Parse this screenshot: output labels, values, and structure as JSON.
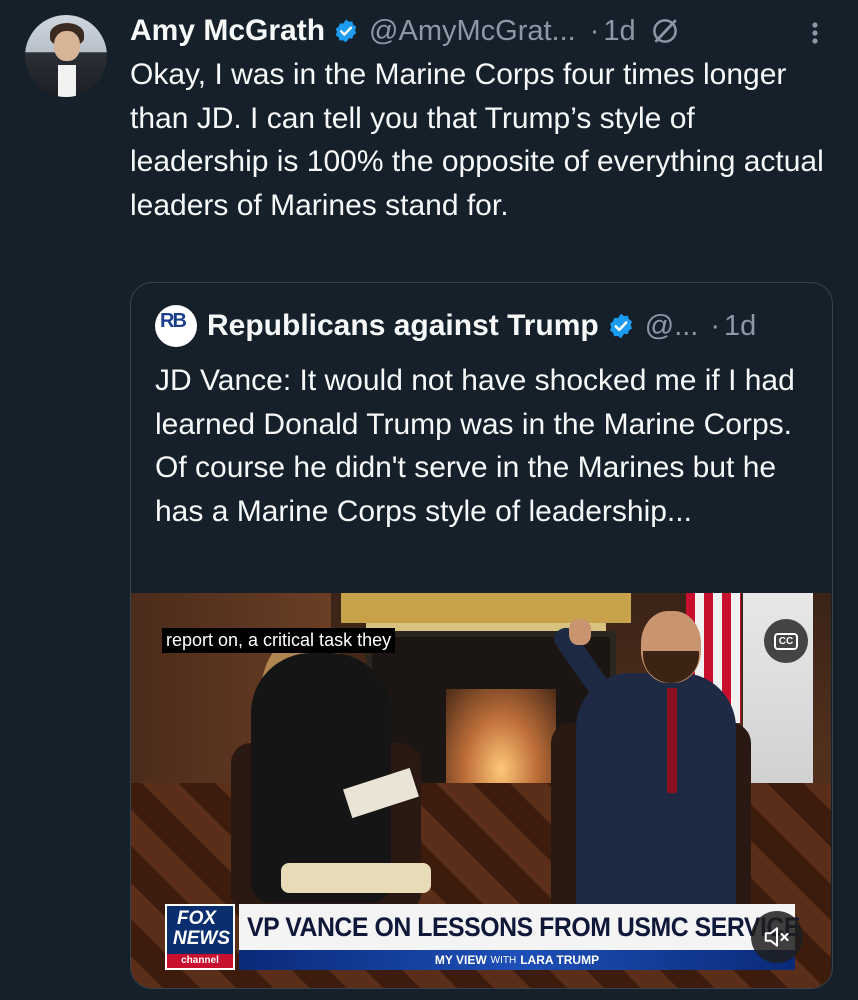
{
  "tweet": {
    "author": {
      "name": "Amy McGrath",
      "handle": "@AmyMcGrat...",
      "time": "1d",
      "separator": "·"
    },
    "text": "Okay, I was in the Marine Corps four times longer than JD. I can tell you that Trump’s style of leadership is 100% the opposite of everything actual leaders of Marines stand for.",
    "icons": [
      "verified-badge-icon",
      "grok-icon",
      "more-options-icon"
    ]
  },
  "quote": {
    "author": {
      "name": "Republicans against Trump",
      "handle": "@...",
      "time": "1d",
      "separator": "·",
      "avatar_letters": "RB"
    },
    "text": "JD Vance: It would not have shocked me if I had learned Donald Trump was in the Marine Corps. Of course he didn't serve in the Marines but he has a Marine Corps style of leadership...",
    "video": {
      "caption": "report on, a critical task they",
      "cc_label": "CC",
      "chyron_headline": "VP VANCE ON LESSONS FROM USMC SERVICE",
      "chyron_show": "MY VIEW",
      "chyron_with": "WITH",
      "chyron_host": "LARA TRUMP",
      "network_logo_top": "FOX",
      "network_logo_mid": "NEWS",
      "network_logo_bottom": "channel"
    }
  },
  "colors": {
    "background": "#15202b",
    "text_primary": "#f7f9f9",
    "text_secondary": "#8b98a5",
    "border": "#38444d",
    "verified_blue": "#1d9bf0"
  }
}
